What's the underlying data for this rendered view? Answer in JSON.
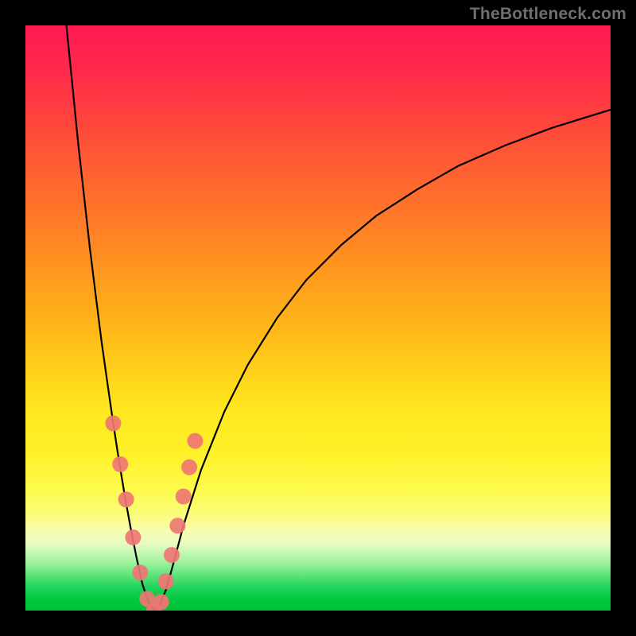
{
  "watermark": "TheBottleneck.com",
  "colors": {
    "frame": "#000000",
    "curve": "#000000",
    "dot": "#ef7674"
  },
  "chart_data": {
    "type": "line",
    "title": "",
    "xlabel": "",
    "ylabel": "",
    "xlim": [
      0,
      100
    ],
    "ylim": [
      0,
      100
    ],
    "grid": false,
    "notes": "V-shaped bottleneck curve over rainbow gradient background (red=high bottleneck at top, green=low at bottom). Minimum near x≈20. Axes unlabeled. Values estimated from pixel positions.",
    "series": [
      {
        "name": "bottleneck-curve",
        "x": [
          7,
          8,
          9,
          10,
          11,
          12,
          13,
          14,
          15,
          16,
          17,
          18,
          19,
          20,
          21,
          22,
          23,
          24,
          25,
          27,
          30,
          34,
          38,
          43,
          48,
          54,
          60,
          67,
          74,
          82,
          90,
          100
        ],
        "y": [
          100,
          90,
          80,
          71,
          62,
          54,
          46,
          39,
          32,
          25.5,
          19.5,
          14,
          9,
          4.5,
          1.5,
          0,
          1,
          3.5,
          7,
          14.5,
          24,
          34,
          42,
          50,
          56.5,
          62.5,
          67.5,
          72,
          76,
          79.5,
          82.5,
          85.6
        ]
      }
    ],
    "markers": [
      {
        "x": 15.0,
        "y": 32.0
      },
      {
        "x": 16.2,
        "y": 25.0
      },
      {
        "x": 17.2,
        "y": 19.0
      },
      {
        "x": 18.4,
        "y": 12.5
      },
      {
        "x": 19.6,
        "y": 6.5
      },
      {
        "x": 20.8,
        "y": 2.0
      },
      {
        "x": 22.0,
        "y": 0.0
      },
      {
        "x": 23.2,
        "y": 1.5
      },
      {
        "x": 24.0,
        "y": 5.0
      },
      {
        "x": 25.0,
        "y": 9.5
      },
      {
        "x": 26.0,
        "y": 14.5
      },
      {
        "x": 27.0,
        "y": 19.5
      },
      {
        "x": 28.0,
        "y": 24.5
      },
      {
        "x": 29.0,
        "y": 29.0
      }
    ]
  }
}
